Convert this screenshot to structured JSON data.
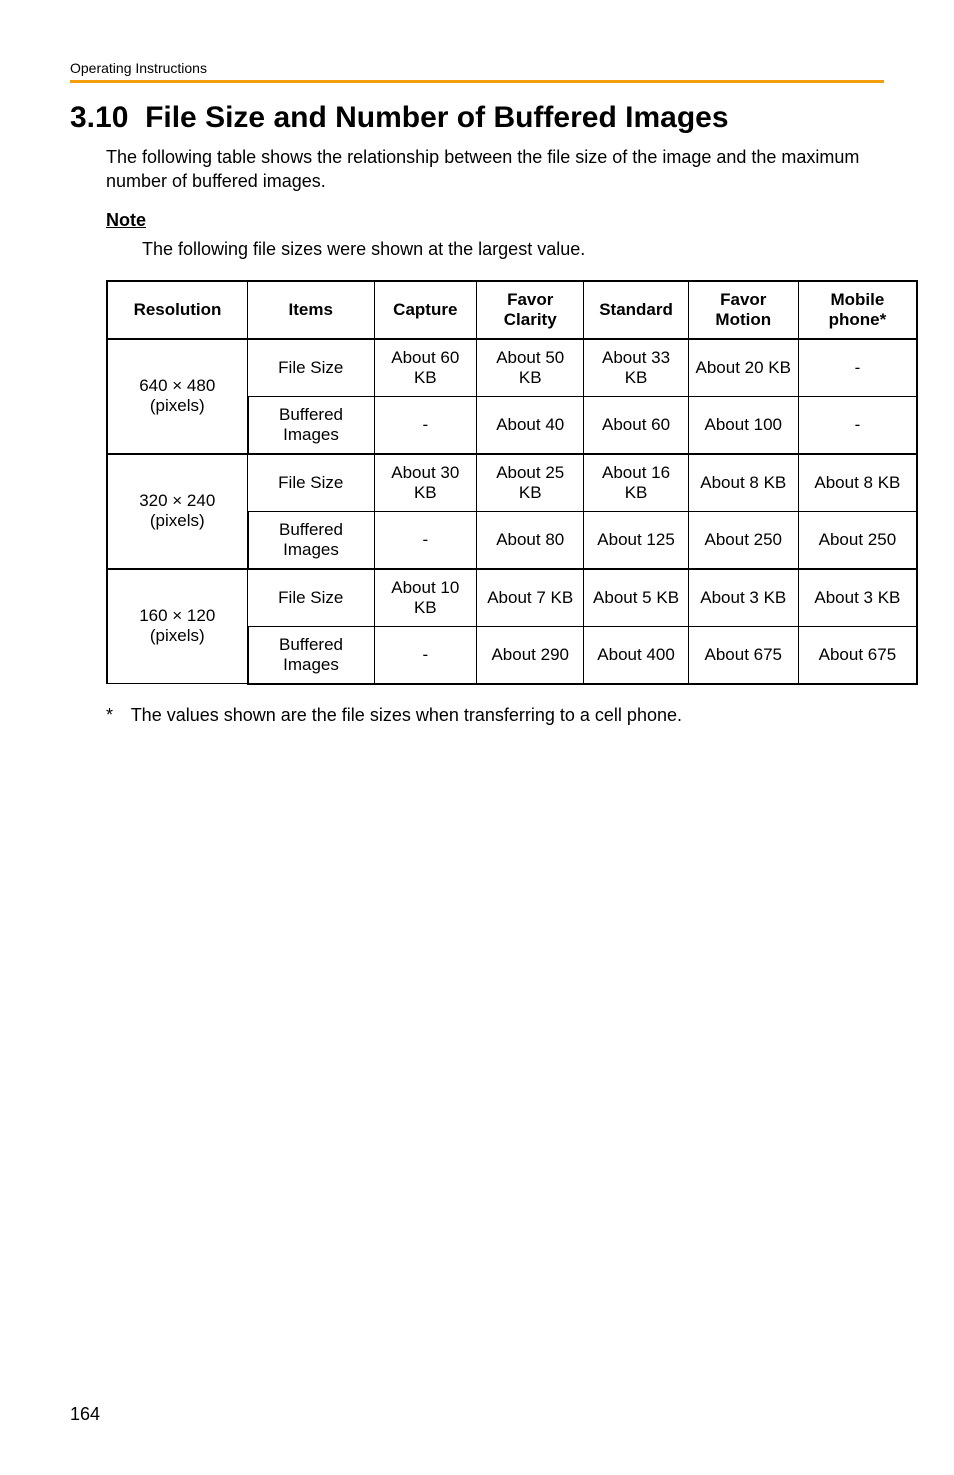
{
  "header": "Operating Instructions",
  "section_number": "3.10",
  "section_title": "File Size and Number of Buffered Images",
  "intro": "The following table shows the relationship between the file size of the image and the maximum number of buffered images.",
  "note_label": "Note",
  "note_text": "The following file sizes were shown at the largest value.",
  "table": {
    "headers": {
      "resolution": "Resolution",
      "items": "Items",
      "capture": "Capture",
      "favor_clarity": "Favor Clarity",
      "standard": "Standard",
      "favor_motion": "Favor Motion",
      "mobile": "Mobile phone*"
    },
    "rows": [
      {
        "resolution": "640 × 480 (pixels)",
        "item": "File Size",
        "capture": "About 60 KB",
        "favor_clarity": "About 50 KB",
        "standard": "About 33 KB",
        "favor_motion": "About 20 KB",
        "mobile": "-"
      },
      {
        "item": "Buffered Images",
        "capture": "-",
        "favor_clarity": "About 40",
        "standard": "About 60",
        "favor_motion": "About 100",
        "mobile": "-"
      },
      {
        "resolution": "320 × 240 (pixels)",
        "item": "File Size",
        "capture": "About 30 KB",
        "favor_clarity": "About 25 KB",
        "standard": "About 16 KB",
        "favor_motion": "About 8 KB",
        "mobile": "About 8 KB"
      },
      {
        "item": "Buffered Images",
        "capture": "-",
        "favor_clarity": "About 80",
        "standard": "About 125",
        "favor_motion": "About 250",
        "mobile": "About 250"
      },
      {
        "resolution": "160 × 120 (pixels)",
        "item": "File Size",
        "capture": "About 10 KB",
        "favor_clarity": "About 7 KB",
        "standard": "About 5 KB",
        "favor_motion": "About 3 KB",
        "mobile": "About 3 KB"
      },
      {
        "item": "Buffered Images",
        "capture": "-",
        "favor_clarity": "About 290",
        "standard": "About 400",
        "favor_motion": "About 675",
        "mobile": "About 675"
      }
    ]
  },
  "footnote_marker": "*",
  "footnote": "The values shown are the file sizes when transferring to a cell phone.",
  "page_number": "164"
}
